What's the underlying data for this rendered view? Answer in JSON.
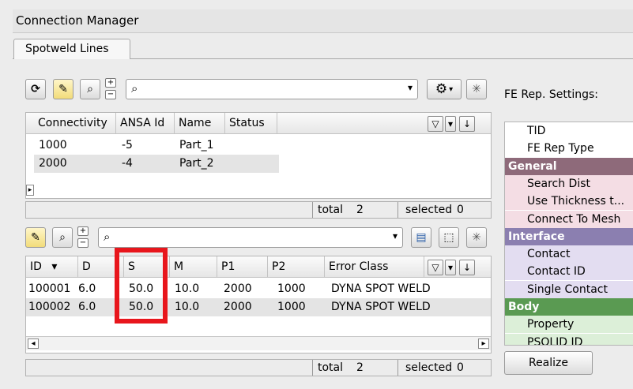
{
  "window": {
    "title": "Connection Manager"
  },
  "tabs": [
    {
      "label": "Spotweld Lines"
    }
  ],
  "upper": {
    "search_placeholder": "",
    "columns": [
      "Connectivity",
      "ANSA Id",
      "Name",
      "Status"
    ],
    "rows": [
      {
        "connectivity": "1000",
        "ansa_id": "-5",
        "name": "Part_1",
        "status": ""
      },
      {
        "connectivity": "2000",
        "ansa_id": "-4",
        "name": "Part_2",
        "status": ""
      }
    ],
    "status": {
      "total_label": "total",
      "total_value": "2",
      "selected_label": "selected",
      "selected_value": "0"
    }
  },
  "lower": {
    "columns": [
      "ID",
      "D",
      "S",
      "M",
      "P1",
      "P2",
      "Error Class"
    ],
    "rows": [
      {
        "id": "100001",
        "d": "6.0",
        "s": "50.0",
        "m": "10.0",
        "p1": "2000",
        "p2": "1000",
        "error_class": "DYNA SPOT WELD"
      },
      {
        "id": "100002",
        "d": "6.0",
        "s": "50.0",
        "m": "10.0",
        "p1": "2000",
        "p2": "1000",
        "error_class": "DYNA SPOT WELD"
      }
    ],
    "status": {
      "total_label": "total",
      "total_value": "2",
      "selected_label": "selected",
      "selected_value": "0"
    }
  },
  "fe_rep": {
    "title": "FE Rep. Settings:",
    "rows": [
      {
        "text": "TID",
        "kind": "item",
        "color": "#ffffff"
      },
      {
        "text": "FE Rep Type",
        "kind": "item",
        "color": "#ffffff"
      },
      {
        "text": "General",
        "kind": "group",
        "color": "#8e6a7a"
      },
      {
        "text": "Search Dist",
        "kind": "item",
        "color": "#f4dde4"
      },
      {
        "text": "Use Thickness t...",
        "kind": "item",
        "color": "#f4dde4"
      },
      {
        "text": "Connect To Mesh",
        "kind": "item",
        "color": "#f4dde4"
      },
      {
        "text": "Interface",
        "kind": "group",
        "color": "#8b7fb0"
      },
      {
        "text": "Contact",
        "kind": "item",
        "color": "#e3ddf1"
      },
      {
        "text": "Contact ID",
        "kind": "item",
        "color": "#e3ddf1"
      },
      {
        "text": "Single Contact",
        "kind": "item",
        "color": "#e3ddf1"
      },
      {
        "text": "Body",
        "kind": "group",
        "color": "#5a9a52"
      },
      {
        "text": "Property",
        "kind": "item",
        "color": "#dcefd8"
      },
      {
        "text": "PSOLID ID",
        "kind": "item",
        "color": "#dcefd8"
      }
    ],
    "realize_label": "Realize"
  },
  "icons": {
    "refresh": "⟳",
    "highlight": "✎",
    "zoom": "⌕",
    "plus": "+",
    "minus": "−",
    "search": "⌕",
    "dropdown": "▾",
    "gear": "⚙",
    "sparkle": "✳",
    "filter": "▽",
    "arrow_down": "↓",
    "left": "◂",
    "right": "▸",
    "sort_down": "▾",
    "grid": "▤",
    "select": "⬚"
  },
  "highlight": {
    "color": "#e8161c"
  }
}
